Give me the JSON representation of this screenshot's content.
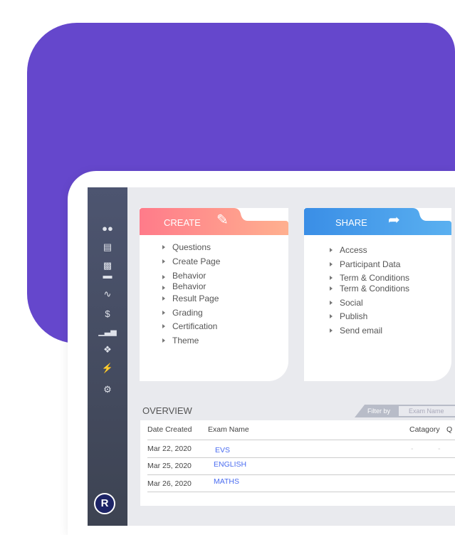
{
  "sidebar": {
    "icons": [
      "users-icon",
      "document-icon",
      "book-icon",
      "trend-icon",
      "dollar-icon",
      "bar-chart-icon",
      "handshake-icon",
      "plug-icon",
      "gear-icon"
    ],
    "logo": "R"
  },
  "create": {
    "title": "CREATE",
    "icon": "edit-icon",
    "color_from": "#ff7b8a",
    "color_to": "#ffb08f",
    "items": [
      "Questions",
      "Create Page",
      "Behavior",
      "Behavior",
      "Result Page",
      "Grading",
      "Certification",
      "Theme"
    ]
  },
  "share": {
    "title": "SHARE",
    "icon": "share-icon",
    "color_from": "#3a8ee6",
    "color_to": "#5ab0f0",
    "items": [
      "Access",
      "Participant Data",
      "Term & Conditions",
      "Term & Conditions",
      "Social",
      "Publish",
      "Send email"
    ]
  },
  "overview": {
    "title": "OVERVIEW",
    "filter_label": "Filter by",
    "filter_placeholder": "Exam Name",
    "columns": [
      "Date Created",
      "Exam Name",
      "Catagory",
      "Q"
    ],
    "rows": [
      {
        "date": "Mar  22, 2020",
        "name": "EVS",
        "cat": "-",
        "q": "-"
      },
      {
        "date": "Mar  25, 2020",
        "name": "ENGLISH"
      },
      {
        "date": "Mar  26, 2020",
        "name": "MATHS"
      }
    ]
  }
}
